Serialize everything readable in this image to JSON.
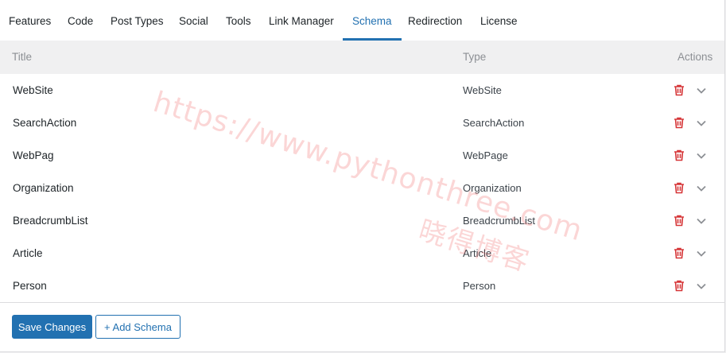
{
  "tabs": [
    {
      "label": "Features"
    },
    {
      "label": "Code"
    },
    {
      "label": "Post Types"
    },
    {
      "label": "Social"
    },
    {
      "label": "Tools"
    },
    {
      "label": "Link Manager"
    },
    {
      "label": "Schema",
      "active": true
    },
    {
      "label": "Redirection"
    },
    {
      "label": "License"
    }
  ],
  "table": {
    "headers": {
      "title": "Title",
      "type": "Type",
      "actions": "Actions"
    },
    "rows": [
      {
        "title": "WebSite",
        "type": "WebSite"
      },
      {
        "title": "SearchAction",
        "type": "SearchAction"
      },
      {
        "title": "WebPag",
        "type": "WebPage"
      },
      {
        "title": "Organization",
        "type": "Organization"
      },
      {
        "title": "BreadcrumbList",
        "type": "BreadcrumbList"
      },
      {
        "title": "Article",
        "type": "Article"
      },
      {
        "title": "Person",
        "type": "Person"
      }
    ],
    "row_icons": {
      "delete": "trash-icon",
      "expand": "chevron-down-icon"
    }
  },
  "buttons": {
    "save": "Save Changes",
    "add": "+ Add Schema"
  },
  "watermark": {
    "url": "https://www.pythonthree.com",
    "cn": "晓得博客"
  },
  "colors": {
    "accent": "#2271b1",
    "delete": "#d63638",
    "header_bg": "#f0f0f1"
  }
}
